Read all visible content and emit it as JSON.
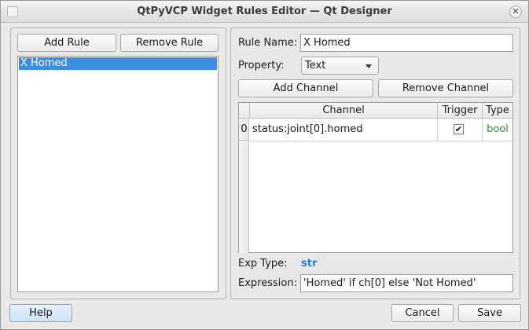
{
  "window": {
    "title": "QtPyVCP Widget Rules Editor — Qt Designer",
    "close_glyph": "✕"
  },
  "rules": {
    "add_label": "Add Rule",
    "remove_label": "Remove Rule",
    "items": [
      {
        "label": "X Homed",
        "selected": true
      }
    ]
  },
  "editor": {
    "rule_name_label": "Rule Name:",
    "rule_name_value": "X Homed",
    "property_label": "Property:",
    "property_value": "Text",
    "add_channel_label": "Add Channel",
    "remove_channel_label": "Remove Channel",
    "table": {
      "headers": [
        "Channel",
        "Trigger",
        "Type"
      ],
      "rows": [
        {
          "index": "0",
          "channel": "status:joint[0].homed",
          "trigger": true,
          "trigger_glyph": "✔",
          "type": "bool"
        }
      ]
    },
    "exp_type_label": "Exp Type:",
    "exp_type_value": "str",
    "expression_label": "Expression:",
    "expression_value": "'Homed' if ch[0] else 'Not Homed'"
  },
  "footer": {
    "help_label": "Help",
    "cancel_label": "Cancel",
    "save_label": "Save"
  },
  "colors": {
    "selection": "#3d8ee0",
    "bool_type": "#2e8b2e",
    "exp_type": "#2f7fd1"
  }
}
